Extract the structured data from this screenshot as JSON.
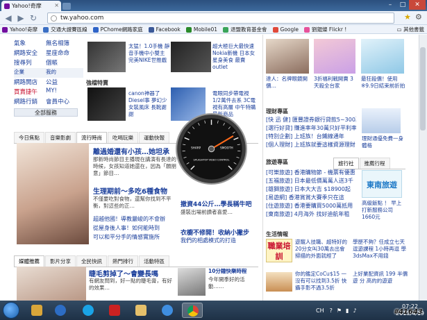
{
  "browser": {
    "tab_title": "Yahoo!奇摩",
    "url": "tw.yahoo.com",
    "window_controls": {
      "minimize": "–",
      "maximize": "□",
      "close": "✕"
    }
  },
  "bookmarks": [
    {
      "label": "Yahoo!奇摩",
      "color": "#720e9e"
    },
    {
      "label": "交通大證賽區線",
      "color": "#3b6fc4"
    },
    {
      "label": "PChome網路家庭",
      "color": "#2f64c8"
    },
    {
      "label": "Facebook",
      "color": "#3b5998"
    },
    {
      "label": "Mobile01",
      "color": "#2a8a2a"
    },
    {
      "label": "退盟教育基金會",
      "color": "#3aa55a"
    },
    {
      "label": "Google",
      "color": "#e0493a"
    },
    {
      "label": "劉錕燦 Flickr !",
      "color": "#e6529a"
    }
  ],
  "bookmarks_other": "其他書籤",
  "left_nav": {
    "rows": [
      [
        "氣象",
        "無名相簿"
      ],
      [
        "網路安全",
        "星座命命"
      ],
      [
        "搜尋列",
        "個帳"
      ],
      [
        "企業",
        "我的"
      ],
      [
        "網路開店",
        "公益"
      ],
      [
        "買賣捷午",
        "MY!"
      ],
      [
        "網路行銷",
        "會員中心"
      ]
    ],
    "all_services": "全部服務"
  },
  "products": [
    {
      "text": "太猛！1.0手機 靜音手機中小雙主 完美NIKE世推戲"
    },
    {
      "text": "超大極巨大最快速 Nokia新機 日本女星身美食 最賣outlet"
    }
  ],
  "strong_rec": "強檔特賣",
  "products2": [
    {
      "text": "canon神器了 Diesel事 夢幻少女裝風床 長靴謝謝"
    },
    {
      "text": "電眼同步帶電視 1/2萬件去系 3C電視有高層 中午特購最新商品"
    }
  ],
  "news_tabs": [
    "今日焦點",
    "音樂影劇",
    "流行時尚",
    "吃喝玩樂",
    "運動快報"
  ],
  "main_story": {
    "headline": "離過婚還有小孩…她坦承",
    "summary": "那新時尚節目主播現在講演有長達的時候，女孩知道她還在，因為「願朋意」節目…"
  },
  "sub_stories": [
    {
      "headline": "生理期前～多吃6種食物",
      "summary": "不僅要吃對食物，還幫你找到不平衡，對這些的正…"
    },
    {
      "headline": "撤資44公斤…學長稱牛吧",
      "summary": "盛裝出場前讀者喜愛…"
    }
  ],
  "bullets": [
    "超越他國！導教嚴峻的不會辦",
    "從屋身後人事！如何能時到",
    "可以和平分手的情感實施所"
  ],
  "bullets_right": [
    "衣櫥不修開！收納小撇步",
    "我們的相處模式的打造"
  ],
  "bottom_tabs": [
    "媒體推薦",
    "影片分享",
    "全民快訊",
    "熱門排行",
    "活動特區"
  ],
  "bottom_story": {
    "headline": "睫毛剪掉了～會變長嗎",
    "summary": "有網友問到，好一點的睫毛膏，有好的效果…"
  },
  "bottom_right": {
    "headline": "10分鐘快樂時程",
    "summary": "今年開季好的活動……"
  },
  "right_top": [
    {
      "text": "達人：名牌眼鏡開價…"
    },
    {
      "text": "3折福利戰開賣 3天殺全台家"
    },
    {
      "text": "最狂殺價！使用 ※9.9日結束前折拍"
    }
  ],
  "finance": {
    "title": "理財專區",
    "lines": [
      "[快 迅 健] 匯豐證券銀行貸款5~300萬",
      "[選行好貸] 賺進率年30萬只好平利率",
      "[特別企劃] 上班族！台鐵線通年",
      "[個人理財] 上班族就要這樣資源理財"
    ],
    "side": "理財通優免費一身體格"
  },
  "travel": {
    "title": "旅遊專區",
    "tabs": [
      "旅行社",
      "推薦行程"
    ],
    "lines": [
      "[可樂旅遊] 香港購物節 - 機票有優惠",
      "[五福旅遊] 日本最低價萬萬人送3千",
      "[雄獅旅遊] 日本大大吉 $18900起",
      "[易遊網] 香港賞賞大賽季只在這",
      "[住遊旅遊] 香港要購買5000萬抵用",
      "[東南旅遊] 4月海外 找好迪航年租"
    ],
    "ad_line": "東南旅遊",
    "ad_side": "高級飯點 ！ 早上打新服務公司1660元"
  },
  "life": {
    "title": "生活情報",
    "banner": "職業培訓",
    "lines": [
      "遊寵人技職、超特好的 20分女叫30萬去出會 掃描的外面就經了",
      "學歷不夠？任成立七天 逗遊課程 1小時再逗 學3dsMax不用錢"
    ],
    "lines2": [
      "你的鑑定CoCu$15 一沒有可以找到3.5折 快攝手影不過3.5折",
      "上好業配資訊 199 半價遊 分 高的的遊遊"
    ]
  },
  "gauge": {
    "label_left": "SHARP",
    "label_right": "SMOOTH",
    "caption": "SPLASHTOP VIDEO CONTROL",
    "level": 0.72
  },
  "tray": {
    "lang": "CH",
    "time": "07:22",
    "date": "2011/4/19"
  },
  "watermark": "#41643",
  "colors": {
    "link": "#1b3f9b",
    "accent_red": "#c8102e",
    "taskbar": "#243a52"
  }
}
